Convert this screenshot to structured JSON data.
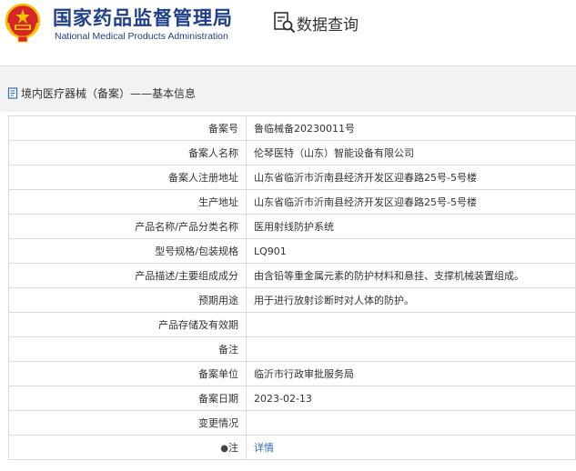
{
  "header": {
    "brand_cn": "国家药品监督管理局",
    "brand_en": "National Medical Products Administration",
    "search_title": "数据查询"
  },
  "section": {
    "title": "境内医疗器械（备案）——基本信息"
  },
  "rows": [
    {
      "label": "备案号",
      "value": "鲁临械备20230011号"
    },
    {
      "label": "备案人名称",
      "value": "伦琴医特（山东）智能设备有限公司"
    },
    {
      "label": "备案人注册地址",
      "value": "山东省临沂市沂南县经济开发区迎春路25号-5号楼"
    },
    {
      "label": "生产地址",
      "value": "山东省临沂市沂南县经济开发区迎春路25号-5号楼"
    },
    {
      "label": "产品名称/产品分类名称",
      "value": "医用射线防护系统"
    },
    {
      "label": "型号规格/包装规格",
      "value": "LQ901"
    },
    {
      "label": "产品描述/主要组成成分",
      "value": "由含铅等重金属元素的防护材料和悬挂、支撑机械装置组成。"
    },
    {
      "label": "预期用途",
      "value": "用于进行放射诊断时对人体的防护。"
    },
    {
      "label": "产品存储及有效期",
      "value": ""
    },
    {
      "label": "备注",
      "value": ""
    },
    {
      "label": "备案单位",
      "value": "临沂市行政审批服务局"
    },
    {
      "label": "备案日期",
      "value": "2023-02-13"
    },
    {
      "label": "变更情况",
      "value": ""
    },
    {
      "label": "注",
      "value": "详情"
    }
  ],
  "colors": {
    "brand_blue": "#1f3f8c",
    "emblem_red": "#d7262b",
    "emblem_gold": "#f5c300",
    "link_blue": "#2a6ebb"
  },
  "icons": [
    "national-emblem-icon",
    "search-data-icon",
    "document-icon",
    "pin-icon"
  ]
}
